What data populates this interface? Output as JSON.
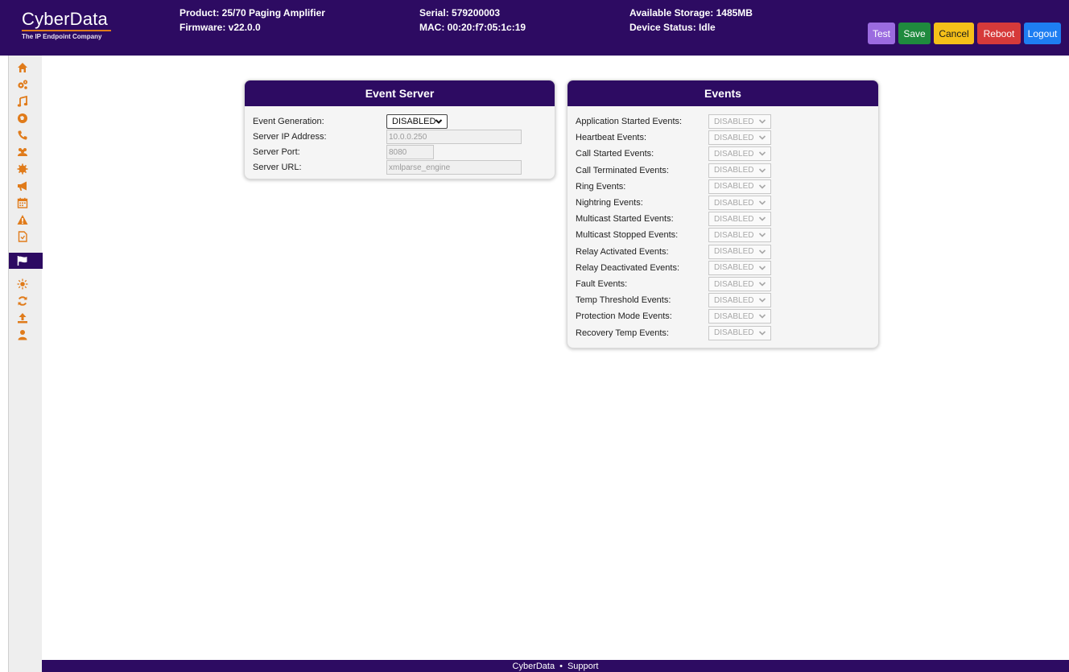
{
  "brand": {
    "name": "CyberData",
    "tagline": "The IP Endpoint Company",
    "accent": "#e07b1a",
    "header_bg": "#2d0b62"
  },
  "header": {
    "product": "Product: 25/70 Paging Amplifier",
    "firmware": "Firmware: v22.0.0",
    "serial": "Serial: 579200003",
    "mac": "MAC: 00:20:f7:05:1c:19",
    "storage": "Available Storage: 1485MB",
    "status": "Device Status: Idle",
    "buttons": {
      "test": "Test",
      "save": "Save",
      "cancel": "Cancel",
      "reboot": "Reboot",
      "logout": "Logout"
    }
  },
  "sidebar": {
    "icons": [
      "home-icon",
      "settings-icon",
      "music-icon",
      "network-icon",
      "phone-icon",
      "users-icon",
      "sip-icon",
      "megaphone-icon",
      "calendar-icon",
      "alert-icon",
      "file-icon",
      "flag-icon",
      "sun-icon",
      "sync-icon",
      "upload-icon",
      "user-icon"
    ],
    "active": "flag-icon"
  },
  "event_server": {
    "title": "Event Server",
    "event_generation": {
      "label": "Event Generation:",
      "value": "DISABLED"
    },
    "server_ip": {
      "label": "Server IP Address:",
      "value": "10.0.0.250"
    },
    "server_port": {
      "label": "Server Port:",
      "value": "8080"
    },
    "server_url": {
      "label": "Server URL:",
      "value": "xmlparse_engine"
    }
  },
  "events": {
    "title": "Events",
    "rows": [
      {
        "label": "Application Started Events:",
        "value": "DISABLED"
      },
      {
        "label": "Heartbeat Events:",
        "value": "DISABLED"
      },
      {
        "label": "Call Started Events:",
        "value": "DISABLED"
      },
      {
        "label": "Call Terminated Events:",
        "value": "DISABLED"
      },
      {
        "label": "Ring Events:",
        "value": "DISABLED"
      },
      {
        "label": "Nightring Events:",
        "value": "DISABLED"
      },
      {
        "label": "Multicast Started Events:",
        "value": "DISABLED"
      },
      {
        "label": "Multicast Stopped Events:",
        "value": "DISABLED"
      },
      {
        "label": "Relay Activated Events:",
        "value": "DISABLED"
      },
      {
        "label": "Relay Deactivated Events:",
        "value": "DISABLED"
      },
      {
        "label": "Fault Events:",
        "value": "DISABLED"
      },
      {
        "label": "Temp Threshold Events:",
        "value": "DISABLED"
      },
      {
        "label": "Protection Mode Events:",
        "value": "DISABLED"
      },
      {
        "label": "Recovery Temp Events:",
        "value": "DISABLED"
      }
    ]
  },
  "footer": {
    "link1": "CyberData",
    "separator": "•",
    "link2": "Support"
  }
}
